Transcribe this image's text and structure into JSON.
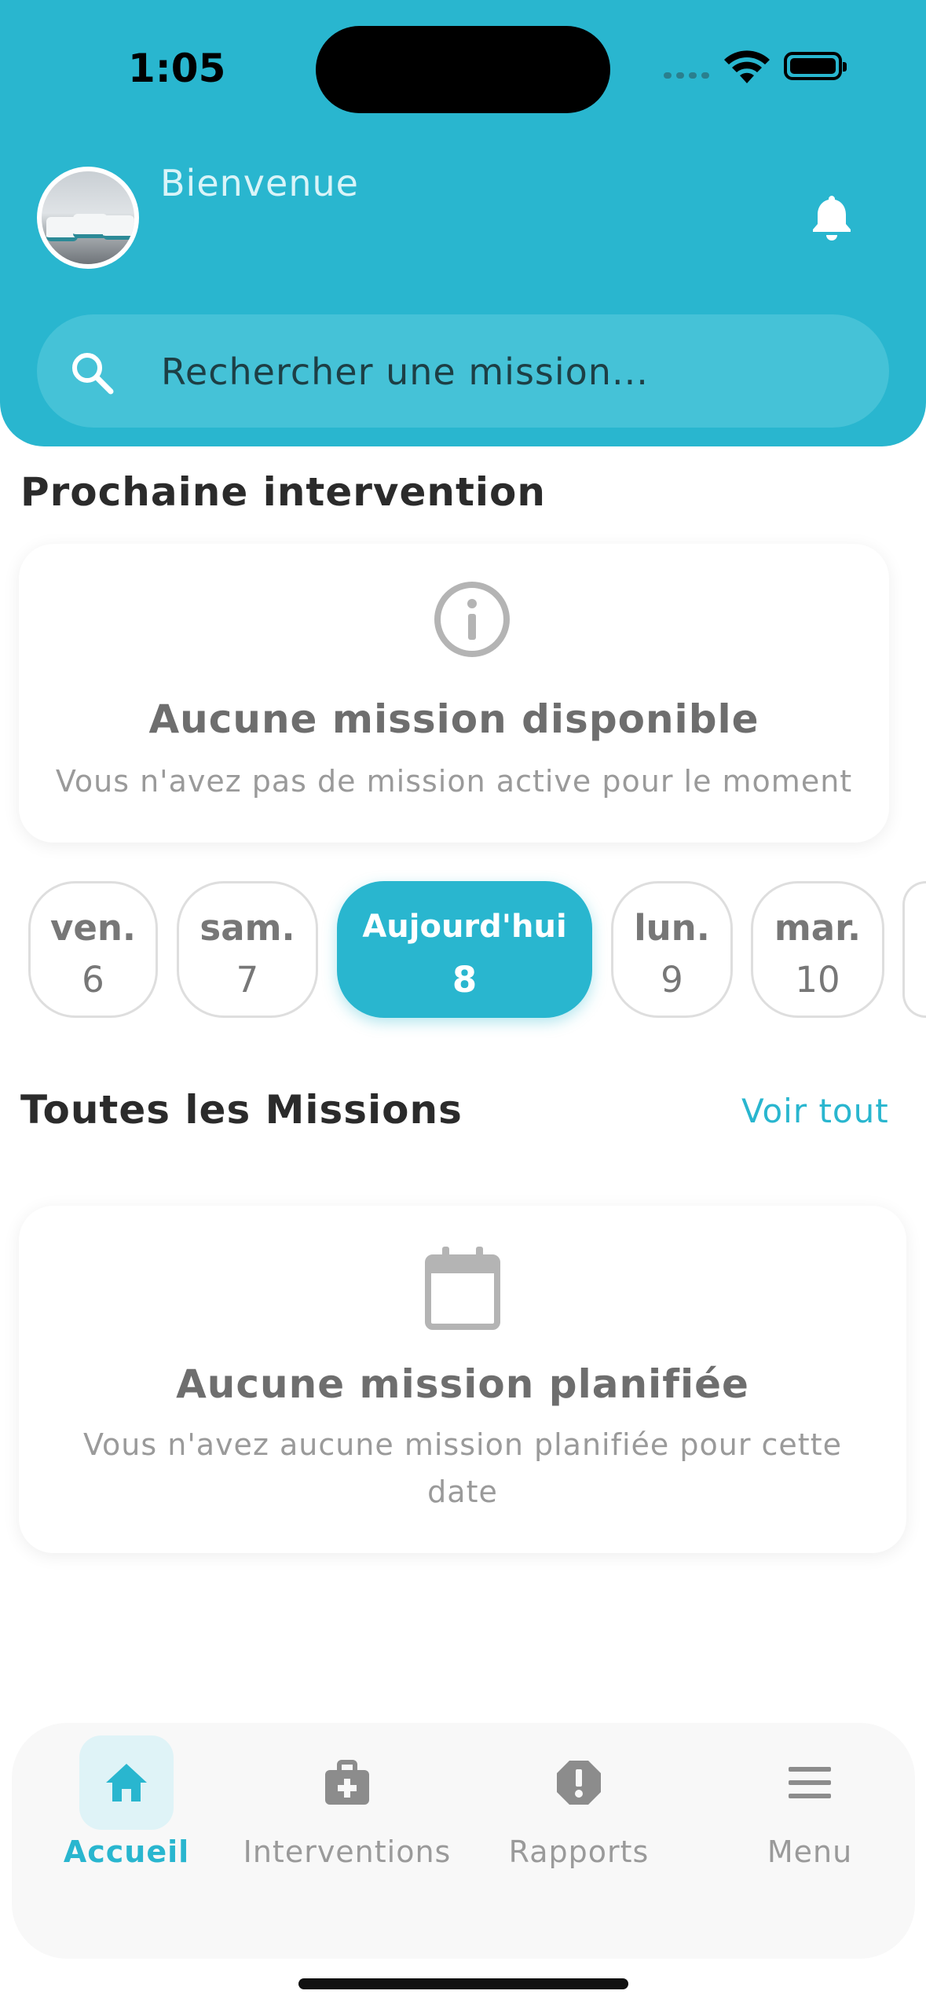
{
  "status_bar": {
    "time": "1:05"
  },
  "header": {
    "welcome": "Bienvenue",
    "avatar_icon": "avatar-photo",
    "notification_icon": "bell-icon",
    "search": {
      "placeholder": "Rechercher une mission...",
      "icon": "search-icon"
    }
  },
  "next_intervention": {
    "title": "Prochaine intervention",
    "empty_state": {
      "icon": "info-icon",
      "title": "Aucune mission disponible",
      "subtitle": "Vous n'avez pas de mission active pour le moment"
    }
  },
  "calendar": {
    "days": [
      {
        "weekday": "ven.",
        "day": "6",
        "active": false
      },
      {
        "weekday": "sam.",
        "day": "7",
        "active": false
      },
      {
        "weekday": "Aujourd'hui",
        "day": "8",
        "active": true
      },
      {
        "weekday": "lun.",
        "day": "9",
        "active": false
      },
      {
        "weekday": "mar.",
        "day": "10",
        "active": false
      }
    ]
  },
  "all_missions": {
    "title": "Toutes les Missions",
    "see_all": "Voir tout",
    "empty_state": {
      "icon": "calendar-icon",
      "title": "Aucune mission planifiée",
      "subtitle": "Vous n'avez aucune mission planifiée pour cette date"
    }
  },
  "bottom_nav": {
    "items": [
      {
        "label": "Accueil",
        "icon": "home-icon",
        "active": true
      },
      {
        "label": "Interventions",
        "icon": "medical-bag-icon",
        "active": false
      },
      {
        "label": "Rapports",
        "icon": "report-alert-icon",
        "active": false
      },
      {
        "label": "Menu",
        "icon": "menu-icon",
        "active": false
      }
    ]
  },
  "colors": {
    "accent": "#29b6cf",
    "muted": "#9a9a9a"
  }
}
